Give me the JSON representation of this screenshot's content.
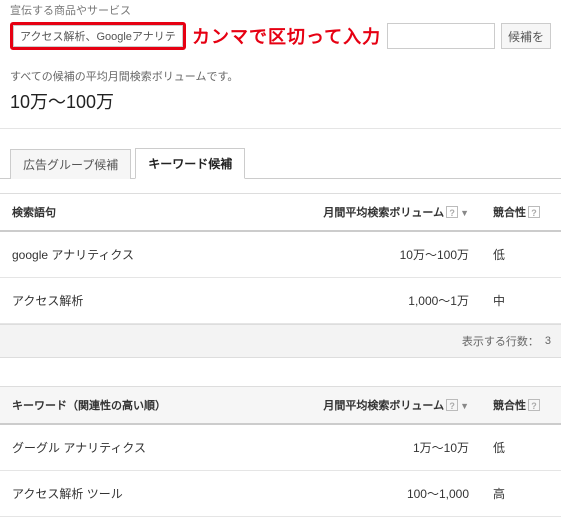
{
  "header": {
    "section_label": "宣伝する商品やサービス",
    "input_value": "アクセス解析、Googleアナリティクス",
    "annotation": "カンマで区切って入力",
    "right_button": "候補を"
  },
  "summary": {
    "desc": "すべての候補の平均月間検索ボリュームです。",
    "volume": "10万～100万"
  },
  "tabs": {
    "group": "広告グループ候補",
    "keyword": "キーワード候補"
  },
  "columns": {
    "term": "検索語句",
    "term2": "キーワード（関連性の高い順）",
    "volume": "月間平均検索ボリューム",
    "competition": "競合性"
  },
  "table1": [
    {
      "term": "google アナリティクス",
      "volume": "10万～100万",
      "comp": "低"
    },
    {
      "term": "アクセス解析",
      "volume": "1,000～1万",
      "comp": "中"
    }
  ],
  "footer": {
    "rows_label": "表示する行数：",
    "rows_value": "3"
  },
  "table2": [
    {
      "term": "グーグル アナリティクス",
      "volume": "1万～10万",
      "comp": "低"
    },
    {
      "term": "アクセス解析 ツール",
      "volume": "100～1,000",
      "comp": "高"
    }
  ]
}
